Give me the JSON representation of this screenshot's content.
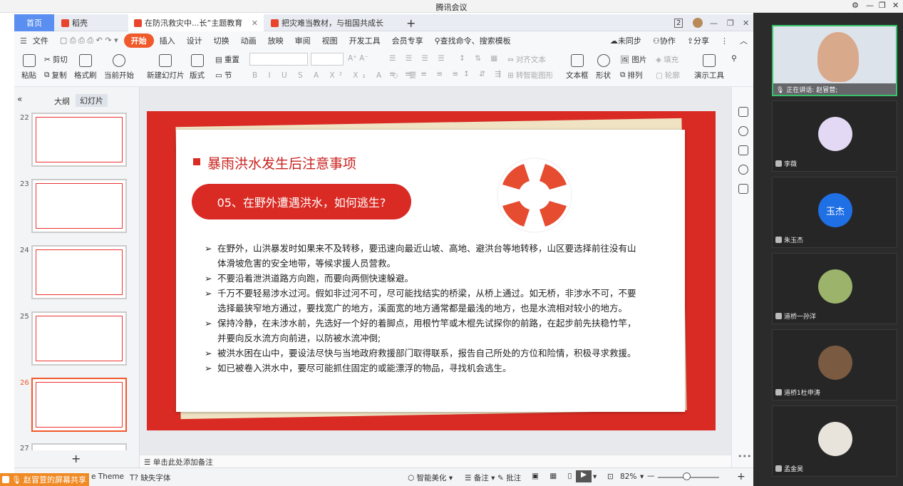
{
  "window": {
    "title": "腾讯会议"
  },
  "tabs": [
    {
      "label": "首页"
    },
    {
      "label": "稻壳"
    },
    {
      "label": "在防汛救灾中...长”主题教育"
    },
    {
      "label": "把灾难当教材，与祖国共成长"
    }
  ],
  "tab_badge": "2",
  "menu": {
    "file": "文件",
    "items": [
      "开始",
      "插入",
      "设计",
      "切换",
      "动画",
      "放映",
      "审阅",
      "视图",
      "开发工具",
      "会员专享"
    ],
    "search_placeholder": "查找命令、搜索模板",
    "unsynced": "未同步",
    "collab": "协作",
    "share": "分享"
  },
  "ribbon": {
    "paste": "粘贴",
    "cut": "剪切",
    "copy": "复制",
    "format_painter": "格式刷",
    "from_current": "当前开始",
    "new_slide": "新建幻灯片",
    "layout": "版式",
    "reset": "重置",
    "section": "节",
    "align_text": "对齐文本",
    "smart_art": "转智能图形",
    "textbox": "文本框",
    "shape": "形状",
    "picture": "图片",
    "fill": "填充",
    "arrange": "排列",
    "outline": "轮廓",
    "demo_tools": "演示工具"
  },
  "left_pane": {
    "tab_outline": "大纲",
    "tab_slides": "幻灯片",
    "slide_numbers": [
      "22",
      "23",
      "24",
      "25",
      "26",
      "27"
    ],
    "add": "+"
  },
  "slide": {
    "title": "暴雨洪水发生后注意事项",
    "banner": "05、在野外遭遇洪水，如何逃生?",
    "bullets": [
      "在野外，山洪暴发时如果来不及转移，要迅速向最近山坡、高地、避洪台等地转移，山区要选择前往没有山体滑坡危害的安全地带，等候求援人员营救。",
      "不要沿着泄洪道路方向跑，而要向两侧快速躲避。",
      "千万不要轻易涉水过河。假如非过河不可，尽可能找结实的桥梁，从桥上通过。如无桥，非涉水不可，不要选择最狭窄地方通过，要找宽广的地方，溪面宽的地方通常都是最浅的地方，也是水流相对较小的地方。",
      "保持冷静，在未涉水前，先选好一个好的着脚点，用根竹竿或木棍先试探你的前路，在起步前先扶稳竹竿，并要向反水流方向前进，以防被水流冲倒;",
      "被洪水困在山中，要设法尽快与当地政府救援部门取得联系，报告自己所处的方位和险情，积极寻求救援。",
      "如已被卷入洪水中，要尽可能抓住固定的或能漂浮的物品，寻找机会逃生。"
    ],
    "accent_color": "#d92b24"
  },
  "notes": {
    "placeholder": "单击此处添加备注"
  },
  "status": {
    "theme": "e Theme",
    "missing_font": "缺失字体",
    "beautify": "智能美化",
    "notes": "备注",
    "comment": "批注",
    "zoom": "82%"
  },
  "meeting": {
    "speaking": "正在讲话: 赵冒营;",
    "participants": [
      "李薇",
      "朱玉杰",
      "道桥一孙洋",
      "道桥1杜申涛",
      "孟金昊"
    ],
    "avatar_text": "玉杰"
  },
  "share_banner": "赵冒萱的屏幕共享"
}
